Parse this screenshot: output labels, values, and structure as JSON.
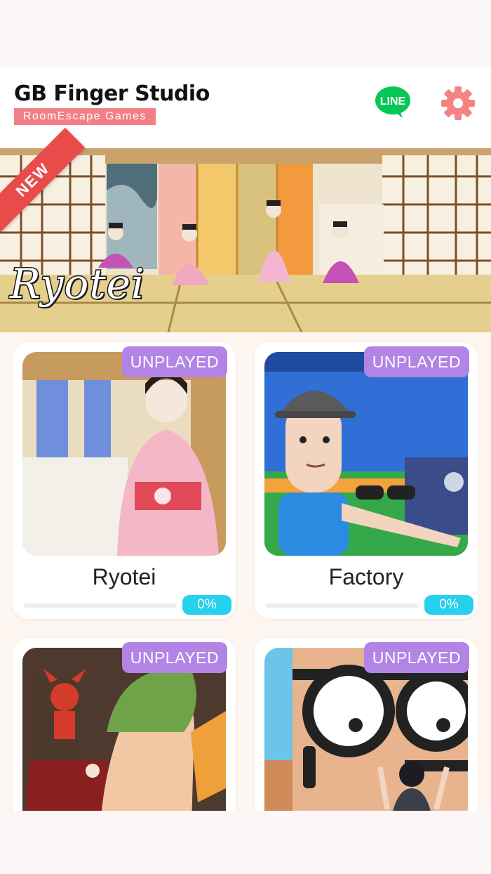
{
  "header": {
    "title": "GB Finger Studio",
    "subtitle": "RoomEscape  Games",
    "line_label": "LINE",
    "line_icon": "line-chat-icon",
    "settings_icon": "gear-icon"
  },
  "banner": {
    "ribbon": "NEW",
    "title": "Ryotei"
  },
  "games": [
    {
      "name": "Ryotei",
      "status": "UNPLAYED",
      "progress": 0,
      "progress_label": "0%"
    },
    {
      "name": "Factory",
      "status": "UNPLAYED",
      "progress": 0,
      "progress_label": "0%"
    },
    {
      "name": "",
      "status": "UNPLAYED",
      "progress": 0,
      "progress_label": ""
    },
    {
      "name": "",
      "status": "UNPLAYED",
      "progress": 0,
      "progress_label": ""
    }
  ],
  "colors": {
    "accent_pink": "#f37f86",
    "line_green": "#06c755",
    "gear_pink": "#f58383",
    "badge_purple": "#b184e6",
    "progress_cyan": "#27d0ec",
    "ribbon_red": "#e94b4b"
  }
}
